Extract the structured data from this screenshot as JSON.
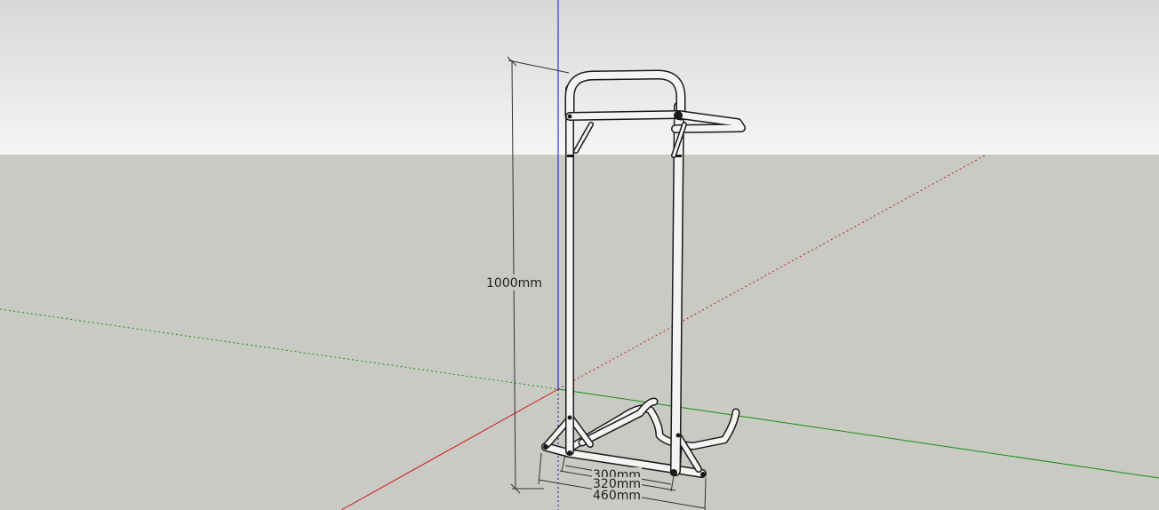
{
  "app": {
    "name": "3D modeling viewport"
  },
  "dimensions": {
    "height_label": "1000mm",
    "width_inner_label": "300mm",
    "width_mid_label": "320mm",
    "width_outer_label": "460mm"
  },
  "colors": {
    "sky_top": "#d8d8d8",
    "sky_bottom": "#f4f4f4",
    "ground": "#cacac5",
    "axis_red": "#d01010",
    "axis_green": "#109010",
    "axis_blue": "#1010c0",
    "model_stroke": "#1a1a1a",
    "model_fill": "#f4f4f2"
  }
}
